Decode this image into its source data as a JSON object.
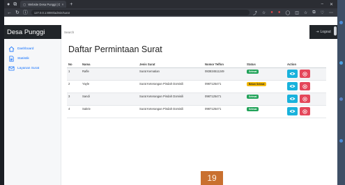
{
  "browser": {
    "tab_title": "Website Desa Punggi | Dashb",
    "url": "127.0.0.1:8000/admin/surat"
  },
  "navbar": {
    "brand": "Desa Punggi",
    "search_placeholder": "Search",
    "logout_label": "Logout"
  },
  "sidebar": {
    "items": [
      {
        "label": "Dashboard",
        "icon": "home-icon"
      },
      {
        "label": "Statistik",
        "icon": "document-icon"
      },
      {
        "label": "Layanan Surat",
        "icon": "mail-icon"
      }
    ]
  },
  "main": {
    "title": "Daftar Permintaan Surat",
    "table": {
      "headers": [
        "No",
        "Nama",
        "Jenis Surat",
        "Nomor Telfon",
        "Status",
        "Action"
      ],
      "rows": [
        {
          "no": "1",
          "nama": "Rafle",
          "jenis": "Surat Kematian",
          "telp": "083834511249",
          "status": "Selesai",
          "status_color": "#22a35a"
        },
        {
          "no": "2",
          "nama": "Yayle",
          "jenis": "Surat Keterangan Pindah Domisili",
          "telp": "0987125471",
          "status": "Belum Selesai",
          "status_color": "#f2b705"
        },
        {
          "no": "3",
          "nama": "Sandi",
          "jenis": "Surat Keterangan Pindah Domisili",
          "telp": "0987125471",
          "status": "Selesai",
          "status_color": "#22a35a"
        },
        {
          "no": "4",
          "nama": "Sakrie",
          "jenis": "Surat Keterangan Pindah Domisili",
          "telp": "0987125471",
          "status": "Selesai",
          "status_color": "#22a35a"
        }
      ]
    }
  },
  "page_number": "19",
  "colors": {
    "primary": "#0d6efd",
    "view_button": "#19b2dc",
    "delete_button": "#e4465a",
    "navbar": "#212529"
  }
}
